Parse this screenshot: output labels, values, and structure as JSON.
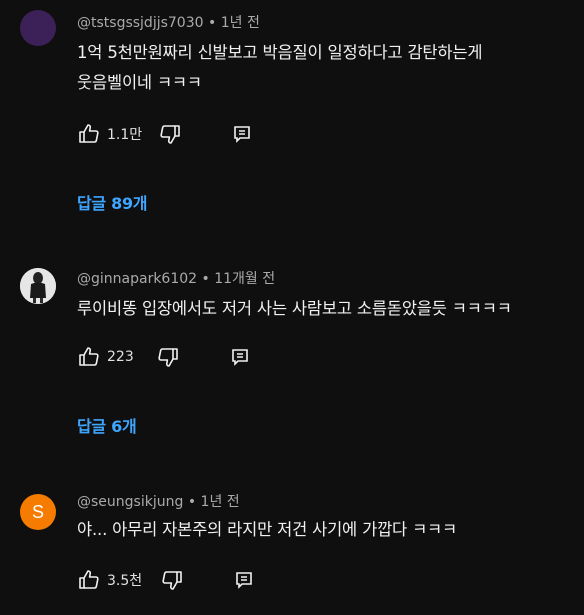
{
  "comments": [
    {
      "handle": "@tstsgssjdjjs7030",
      "time": "1년 전",
      "text_line1": "1억 5천만원짜리 신발보고 박음질이 일정하다고 감탄하는게",
      "text_line2": "웃음벨이네 ㅋㅋㅋ",
      "likes": "1.1만",
      "replies": "답글 89개",
      "avatar_color": "#3b2158"
    },
    {
      "handle": "@ginnapark6102",
      "time": "11개월 전",
      "text_line1": "루이비똥 입장에서도 저거 사는 사람보고 소름돋았을듯 ㅋㅋㅋㅋ",
      "likes": "223",
      "replies": "답글 6개",
      "avatar_color": "#d9d9d9"
    },
    {
      "handle": "@seungsikjung",
      "time": "1년 전",
      "avatar_letter": "S",
      "text_line1": "야... 아무리 자본주의 라지만 저건 사기에 가깝다 ㅋㅋㅋ",
      "likes": "3.5천",
      "avatar_color": "#f57c00"
    }
  ],
  "separator": "•",
  "icons": [
    "thumbs-up-icon",
    "thumbs-down-icon",
    "reply-icon"
  ],
  "colors": {
    "background": "#0f0f0f",
    "link": "#3ea6ff",
    "meta": "#aaaaaa"
  }
}
